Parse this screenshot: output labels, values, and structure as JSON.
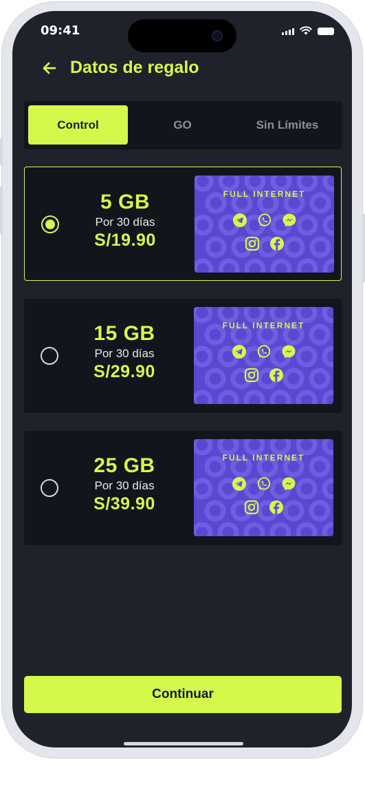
{
  "status_bar": {
    "time": "09:41"
  },
  "header": {
    "title": "Datos de regalo",
    "back_icon": "arrow-left-icon"
  },
  "tabs": [
    {
      "label": "Control",
      "active": true
    },
    {
      "label": "GO",
      "active": false
    },
    {
      "label": "Sin Límites",
      "active": false
    }
  ],
  "plans": [
    {
      "data": "5 GB",
      "period": "Por 30 días",
      "price": "S/19.90",
      "selected": true,
      "promo_title": "FULL INTERNET"
    },
    {
      "data": "15 GB",
      "period": "Por 30 días",
      "price": "S/29.90",
      "selected": false,
      "promo_title": "FULL INTERNET"
    },
    {
      "data": "25 GB",
      "period": "Por 30 días",
      "price": "S/39.90",
      "selected": false,
      "promo_title": "FULL INTERNET"
    }
  ],
  "promo_icons": [
    "telegram-icon",
    "whatsapp-icon",
    "messenger-icon",
    "instagram-icon",
    "facebook-icon"
  ],
  "continue_button": {
    "label": "Continuar"
  },
  "colors": {
    "accent": "#d4f94a",
    "background": "#1f222b",
    "card": "#13151c",
    "promo": "#5a48d2"
  }
}
